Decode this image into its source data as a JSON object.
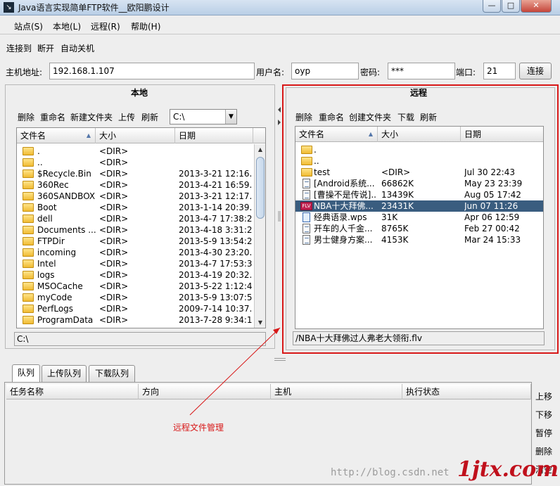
{
  "window": {
    "title": "Java语言实现简单FTP软件__欧阳鹏设计",
    "app_icon_glyph": "↘",
    "min_glyph": "—",
    "max_glyph": "□",
    "close_glyph": "✕"
  },
  "menu": [
    "站点(S)",
    "本地(L)",
    "远程(R)",
    "帮助(H)"
  ],
  "toolbar": [
    "连接到",
    "断开",
    "自动关机"
  ],
  "connection": {
    "host_label": "主机地址:",
    "host_value": "192.168.1.107",
    "user_label": "用户名:",
    "user_value": "oyp",
    "password_label": "密码:",
    "password_value": "***",
    "port_label": "端口:",
    "port_value": "21",
    "connect_label": "连接"
  },
  "local": {
    "title": "本地",
    "actions": [
      "删除",
      "重命名",
      "新建文件夹",
      "上传",
      "刷新"
    ],
    "drive": "C:\\",
    "columns": [
      "文件名",
      "大小",
      "日期"
    ],
    "rows": [
      {
        "name": ".",
        "size": "<DIR>",
        "date": "",
        "icon": "folder"
      },
      {
        "name": "..",
        "size": "<DIR>",
        "date": "",
        "icon": "folder"
      },
      {
        "name": "$Recycle.Bin",
        "size": "<DIR>",
        "date": "2013-3-21 12:16...",
        "icon": "folder"
      },
      {
        "name": "360Rec",
        "size": "<DIR>",
        "date": "2013-4-21 16:59...",
        "icon": "folder"
      },
      {
        "name": "360SANDBOX",
        "size": "<DIR>",
        "date": "2013-3-21 12:17...",
        "icon": "folder"
      },
      {
        "name": "Boot",
        "size": "<DIR>",
        "date": "2013-1-14 20:39...",
        "icon": "folder"
      },
      {
        "name": "dell",
        "size": "<DIR>",
        "date": "2013-4-7 17:38:21",
        "icon": "folder"
      },
      {
        "name": "Documents ...",
        "size": "<DIR>",
        "date": "2013-4-18 3:31:24",
        "icon": "folder"
      },
      {
        "name": "FTPDir",
        "size": "<DIR>",
        "date": "2013-5-9 13:54:27",
        "icon": "folder"
      },
      {
        "name": "incoming",
        "size": "<DIR>",
        "date": "2013-4-30 23:20...",
        "icon": "folder"
      },
      {
        "name": "Intel",
        "size": "<DIR>",
        "date": "2013-4-7 17:53:32",
        "icon": "folder"
      },
      {
        "name": "logs",
        "size": "<DIR>",
        "date": "2013-4-19 20:32...",
        "icon": "folder"
      },
      {
        "name": "MSOCache",
        "size": "<DIR>",
        "date": "2013-5-22 1:12:43",
        "icon": "folder"
      },
      {
        "name": "myCode",
        "size": "<DIR>",
        "date": "2013-5-9 13:07:50",
        "icon": "folder"
      },
      {
        "name": "PerfLogs",
        "size": "<DIR>",
        "date": "2009-7-14 10:37...",
        "icon": "folder"
      },
      {
        "name": "ProgramData",
        "size": "<DIR>",
        "date": "2013-7-28 9:34:19",
        "icon": "folder"
      }
    ],
    "path": "C:\\"
  },
  "remote": {
    "title": "远程",
    "actions": [
      "删除",
      "重命名",
      "创建文件夹",
      "下载",
      "刷新"
    ],
    "columns": [
      "文件名",
      "大小",
      "日期"
    ],
    "rows": [
      {
        "name": ".",
        "size": "",
        "date": "",
        "icon": "folder"
      },
      {
        "name": "..",
        "size": "",
        "date": "",
        "icon": "folder"
      },
      {
        "name": "test",
        "size": "<DIR>",
        "date": "Jul 30 22:43",
        "icon": "folder"
      },
      {
        "name": "[Android系统...",
        "size": "66862K",
        "date": "May 23 23:39",
        "icon": "doc"
      },
      {
        "name": "[曹操不是传说]...",
        "size": "13439K",
        "date": "Aug 05 17:42",
        "icon": "doc"
      },
      {
        "name": "NBA十大拜佛...",
        "size": "23431K",
        "date": "Jun 07 11:26",
        "icon": "flv",
        "selected": true
      },
      {
        "name": "经典语录.wps",
        "size": "31K",
        "date": "Apr 06 12:59",
        "icon": "wps"
      },
      {
        "name": "开车的人千金...",
        "size": "8765K",
        "date": "Feb 27 00:42",
        "icon": "doc"
      },
      {
        "name": "男士健身方案...",
        "size": "4153K",
        "date": "Mar 24 15:33",
        "icon": "doc"
      }
    ],
    "path": "/NBA十大拜佛过人弗老大领衔.flv",
    "flv_badge": "FLV"
  },
  "queue": {
    "tabs": [
      "队列",
      "上传队列",
      "下载队列"
    ],
    "columns": [
      "任务名称",
      "方向",
      "主机",
      "执行状态"
    ],
    "side_buttons": [
      "上移",
      "下移",
      "暂停",
      "删除",
      "清空"
    ]
  },
  "annotation": {
    "text": "远程文件管理",
    "color": "#d81818"
  },
  "watermark": "http://blog.csdn.net",
  "brand": "1jtx.com"
}
